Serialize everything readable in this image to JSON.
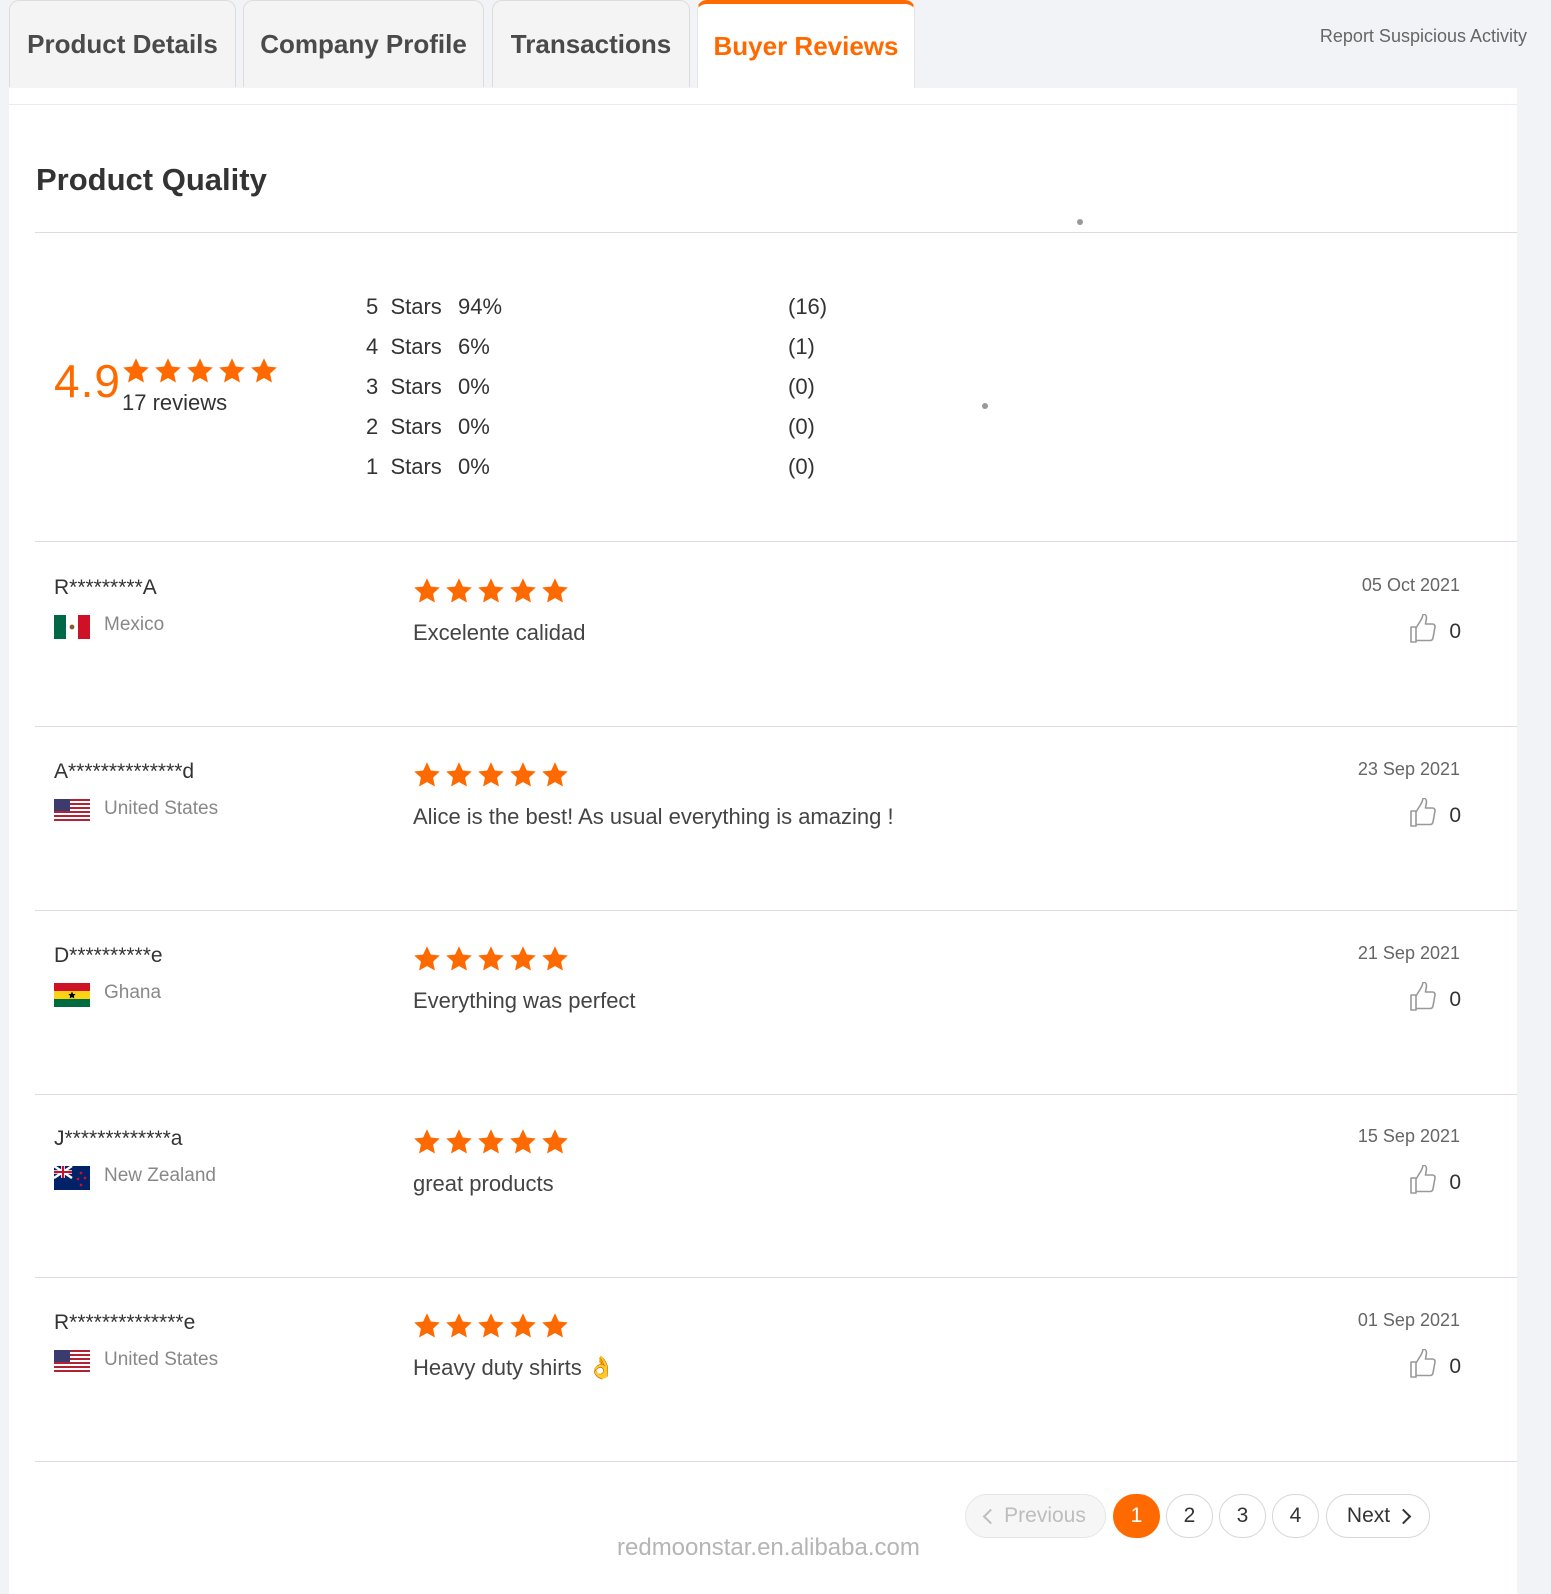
{
  "tabs": [
    {
      "label": "Product Details",
      "active": false
    },
    {
      "label": "Company Profile",
      "active": false
    },
    {
      "label": "Transactions",
      "active": false
    },
    {
      "label": "Buyer Reviews",
      "active": true
    }
  ],
  "report_link": "Report Suspicious Activity",
  "section_title": "Product Quality",
  "summary": {
    "average": "4.9",
    "review_count_text": "17 reviews",
    "rating_stars": 5,
    "distribution": [
      {
        "label": "5  Stars",
        "percent": "94%",
        "count": "(16)"
      },
      {
        "label": "4  Stars",
        "percent": "6%",
        "count": "(1)"
      },
      {
        "label": "3  Stars",
        "percent": "0%",
        "count": "(0)"
      },
      {
        "label": "2  Stars",
        "percent": "0%",
        "count": "(0)"
      },
      {
        "label": "1  Stars",
        "percent": "0%",
        "count": "(0)"
      }
    ]
  },
  "reviews": [
    {
      "name": "R*********A",
      "country": "Mexico",
      "flag": "mexico-flag-icon",
      "stars": 5,
      "comment": "Excelente calidad",
      "date": "05 Oct 2021",
      "likes": "0"
    },
    {
      "name": "A**************d",
      "country": "United States",
      "flag": "usa-flag-icon",
      "stars": 5,
      "comment": "Alice is the best! As usual everything is amazing !",
      "date": "23 Sep 2021",
      "likes": "0"
    },
    {
      "name": "D**********e",
      "country": "Ghana",
      "flag": "ghana-flag-icon",
      "stars": 5,
      "comment": "Everything was perfect",
      "date": "21 Sep 2021",
      "likes": "0"
    },
    {
      "name": "J*************a",
      "country": "New Zealand",
      "flag": "new-zealand-flag-icon",
      "stars": 5,
      "comment": "great products",
      "date": "15 Sep 2021",
      "likes": "0"
    },
    {
      "name": "R**************e",
      "country": "United States",
      "flag": "usa-flag-icon",
      "stars": 5,
      "comment": "Heavy duty shirts 👌",
      "date": "01 Sep 2021",
      "likes": "0"
    }
  ],
  "pagination": {
    "previous": "Previous",
    "pages": [
      "1",
      "2",
      "3",
      "4"
    ],
    "current": "1",
    "next": "Next"
  },
  "watermark": "redmoonstar.en.alibaba.com",
  "colors": {
    "accent": "#ff6a00",
    "star": "#ff6a00"
  }
}
